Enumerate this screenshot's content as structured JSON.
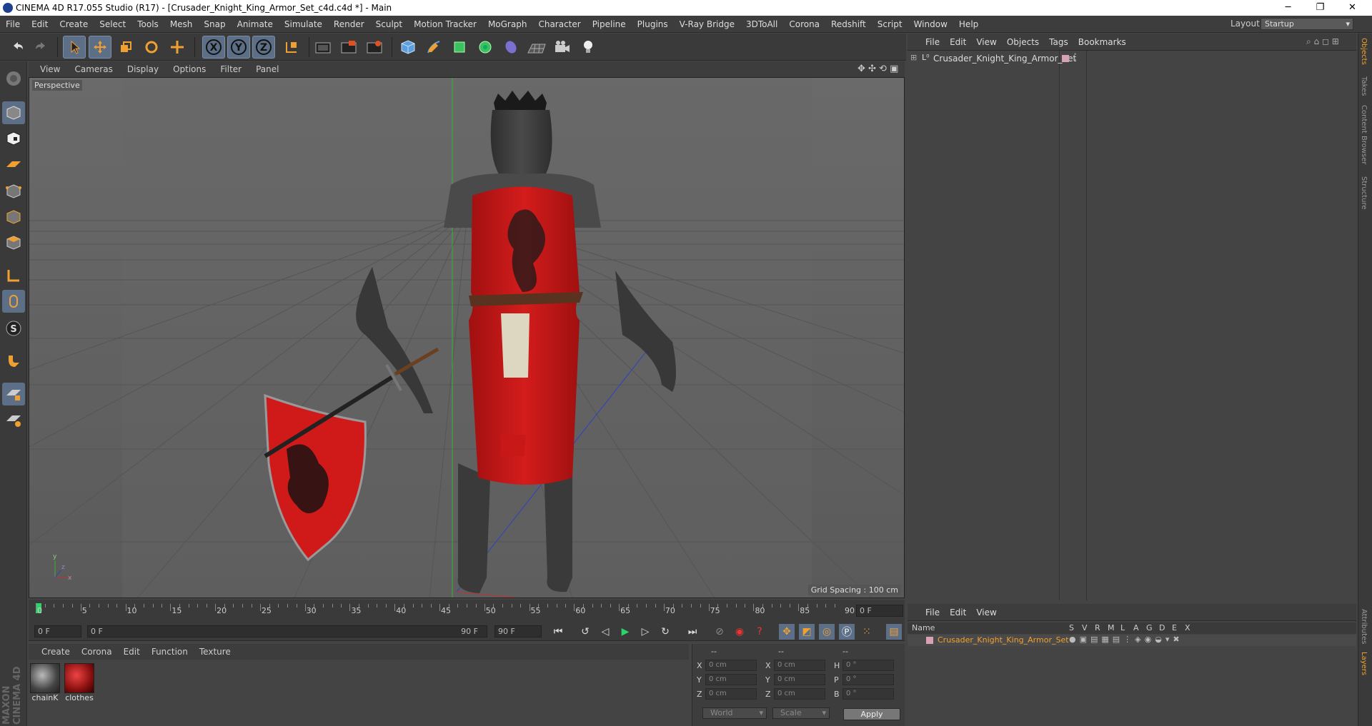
{
  "window": {
    "title": "CINEMA 4D R17.055 Studio (R17) - [Crusader_Knight_King_Armor_Set_c4d.c4d *] - Main",
    "minimize": "─",
    "restore": "❐",
    "close": "✕"
  },
  "menubar": {
    "items": [
      "File",
      "Edit",
      "Create",
      "Select",
      "Tools",
      "Mesh",
      "Snap",
      "Animate",
      "Simulate",
      "Render",
      "Sculpt",
      "Motion Tracker",
      "MoGraph",
      "Character",
      "Pipeline",
      "Plugins",
      "V-Ray Bridge",
      "3DToAll",
      "Corona",
      "Redshift",
      "Script",
      "Window",
      "Help"
    ],
    "layout_label": "Layout:",
    "layout_value": "Startup"
  },
  "toolbar": {
    "icons": [
      "undo-icon",
      "redo-icon",
      "select-icon",
      "move-icon",
      "scale-icon",
      "rotate-icon",
      "transform-icon",
      "x-axis-icon",
      "y-axis-icon",
      "z-axis-icon",
      "coordinate-system-icon",
      "render-view-icon",
      "render-picture-viewer-icon",
      "edit-render-settings-icon",
      "cube-icon",
      "pen-icon",
      "subdivision-icon",
      "cloner-icon",
      "deformer-icon",
      "floor-icon",
      "camera-icon",
      "light-icon"
    ],
    "axis_labels": [
      "X",
      "Y",
      "Z"
    ]
  },
  "viewport": {
    "menu": [
      "View",
      "Cameras",
      "Display",
      "Options",
      "Filter",
      "Panel"
    ],
    "label": "Perspective",
    "grid_spacing": "Grid Spacing : 100 cm"
  },
  "timeline": {
    "ticks": [
      "0",
      "5",
      "10",
      "15",
      "20",
      "25",
      "30",
      "35",
      "40",
      "45",
      "50",
      "55",
      "60",
      "65",
      "70",
      "75",
      "80",
      "85",
      "90"
    ],
    "current_frame": "0 F"
  },
  "transport": {
    "start": "0 F",
    "range_start": "0 F",
    "range_end": "90 F",
    "end": "90 F"
  },
  "materials": {
    "menu": [
      "Create",
      "Corona",
      "Edit",
      "Function",
      "Texture"
    ],
    "items": [
      {
        "name": "chainK"
      },
      {
        "name": "clothes"
      }
    ]
  },
  "coords": {
    "headers": [
      "--",
      "--",
      "--"
    ],
    "rows": [
      {
        "a": "X",
        "av": "0 cm",
        "b": "X",
        "bv": "0 cm",
        "c": "H",
        "cv": "0 °"
      },
      {
        "a": "Y",
        "av": "0 cm",
        "b": "Y",
        "bv": "0 cm",
        "c": "P",
        "cv": "0 °"
      },
      {
        "a": "Z",
        "av": "0 cm",
        "b": "Z",
        "bv": "0 cm",
        "c": "B",
        "cv": "0 °"
      }
    ],
    "world": "World",
    "scale": "Scale",
    "apply": "Apply"
  },
  "objects": {
    "menu": [
      "File",
      "Edit",
      "View",
      "Objects",
      "Tags",
      "Bookmarks"
    ],
    "item": "Crusader_Knight_King_Armor_Set"
  },
  "layers": {
    "menu": [
      "File",
      "Edit",
      "View"
    ],
    "headers": [
      "Name",
      "S",
      "V",
      "R",
      "M",
      "L",
      "A",
      "G",
      "D",
      "E",
      "X"
    ],
    "item": "Crusader_Knight_King_Armor_Set"
  },
  "sidetabs": [
    "Objects",
    "Takes",
    "Content Browser",
    "Structure",
    "Attributes",
    "Layers"
  ],
  "maxon": "MAXON CINEMA 4D",
  "colors": {
    "accent": "#f0a030",
    "highlight": "#5d6f87",
    "tunic": "#c81818"
  }
}
